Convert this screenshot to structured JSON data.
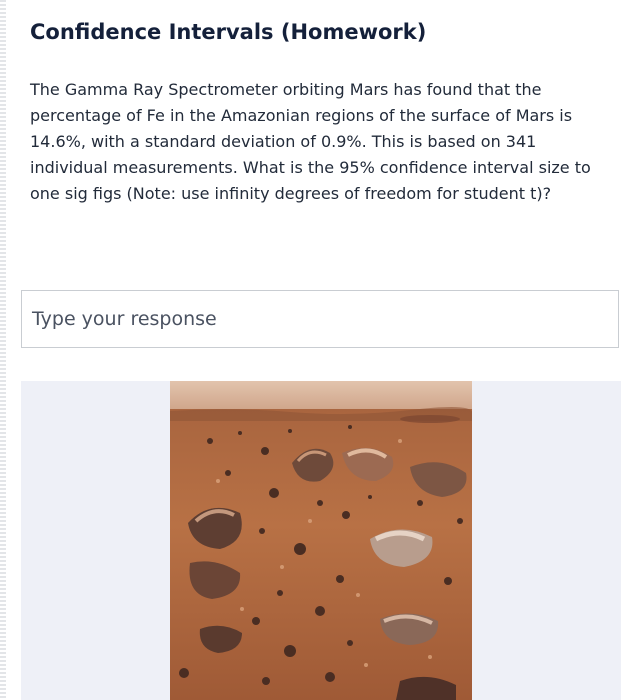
{
  "page": {
    "title": "Confidence Intervals (Homework)",
    "question": "The Gamma Ray Spectrometer orbiting Mars has found that the percentage of Fe in the Amazonian regions of the surface of Mars is 14.6%, with a standard deviation of 0.9%.  This is based on 341 individual measurements.  What is the 95% confidence interval size to one sig figs (Note:  use infinity degrees of freedom for student t)?"
  },
  "response": {
    "placeholder": "Type your response"
  },
  "figure": {
    "subject": "mars-surface-rocks-photo"
  },
  "colors": {
    "title": "#14203a",
    "text": "#222b3a",
    "placeholder": "#4a5261",
    "border": "#c9cdd2",
    "panel": "#eef0f7",
    "sky": "#d7b7a0",
    "soil": "#b3683d"
  }
}
